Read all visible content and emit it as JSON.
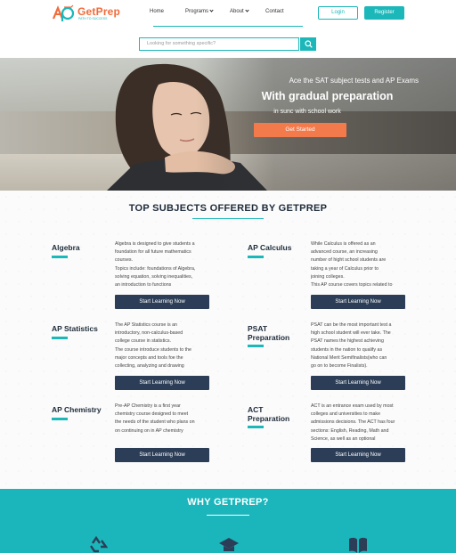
{
  "brand": {
    "name_part1": "Get",
    "name_part2": "Prep",
    "tagline": "PATH TO SUCCESS"
  },
  "nav": {
    "items": [
      {
        "label": "Home",
        "has_dropdown": false
      },
      {
        "label": "Programs",
        "has_dropdown": true
      },
      {
        "label": "About",
        "has_dropdown": true
      },
      {
        "label": "Contact",
        "has_dropdown": false
      }
    ],
    "login_label": "Login",
    "register_label": "Register"
  },
  "search": {
    "placeholder": "Looking for something specific?",
    "icon": "search-icon"
  },
  "hero": {
    "line1": "Ace the SAT subject tests and AP Exams",
    "line2": "With gradual preparation",
    "line3": "in sunc with school work",
    "cta_label": "Get Started"
  },
  "subjects": {
    "title": "TOP SUBJECTS OFFERED BY GETPREP",
    "button_label": "Start Learning Now",
    "items": [
      {
        "title_lines": [
          "Algebra"
        ],
        "desc_lines": [
          "Algebra is designed to give students a",
          "foundation for all future mathematics",
          "courses.",
          "Topics include: foundations of Algebra,",
          "solving equation, solving inequalities,",
          "an introduction to functions"
        ]
      },
      {
        "title_lines": [
          "AP Calculus"
        ],
        "desc_lines": [
          "While Calculus is offered as an",
          "advanced course, an increasing",
          "number of hight school students are",
          "taking a year of Calculus prior to",
          "joining colleges.",
          "This AP course covers topics related to"
        ]
      },
      {
        "title_lines": [
          "AP Statistics"
        ],
        "desc_lines": [
          "The AP Statistics course is an",
          "introductory, non-calculus-based",
          "college course in statistics.",
          "The course introduce students to the",
          "major concepts and tools foe the",
          "collecting, analyzing and drawing"
        ]
      },
      {
        "title_lines": [
          "PSAT",
          "Preparation"
        ],
        "desc_lines": [
          "PSAT can be the most important test a",
          "high school student will ever take. The",
          "PSAT names the highest achieving",
          "students in the nation to qualify as",
          "National Merit Semifinalists(who can",
          "go on to become Finalists)."
        ]
      },
      {
        "title_lines": [
          "AP Chemistry"
        ],
        "desc_lines": [
          "Pre-AP Chemistry is a first year",
          "chemistry course designed to meet",
          "the needs of the student who plans on",
          "on continuing on in AP chemistry"
        ]
      },
      {
        "title_lines": [
          "ACT",
          "Preparation"
        ],
        "desc_lines": [
          "ACT is an entrance exam used by most",
          "colleges and universities to make",
          "admissions decisions. The ACT has four",
          "sections: English, Reading, Math and",
          "Science, as well as an optional"
        ]
      }
    ]
  },
  "why": {
    "title": "WHY GETPREP?",
    "icons": [
      "recycle-icon",
      "graduation-cap-icon",
      "open-book-icon"
    ]
  },
  "colors": {
    "accent": "#1bb7b9",
    "orange": "#f27a4b",
    "navy_button": "#2c3e57",
    "why_background": "#1ab6bb"
  }
}
